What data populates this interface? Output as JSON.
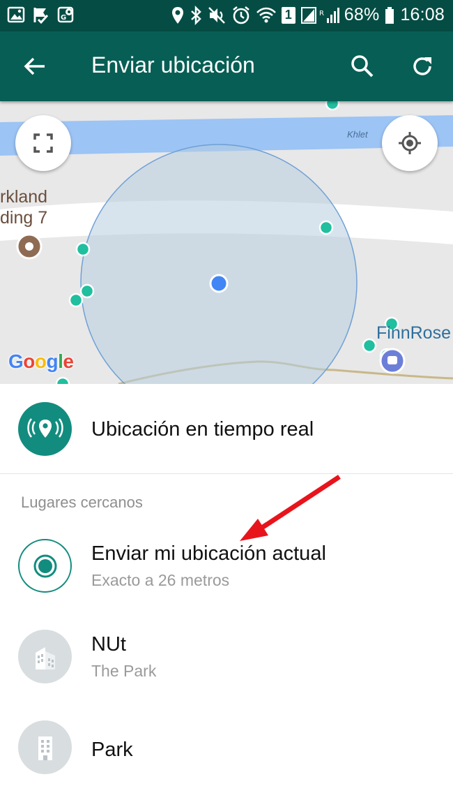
{
  "status_bar": {
    "battery": "68%",
    "time": "16:08",
    "sim_badge": "1"
  },
  "toolbar": {
    "title": "Enviar ubicación"
  },
  "map": {
    "place_label_line1": "rkland",
    "place_label_line2": "ding 7",
    "river_label": "Khlet",
    "poi_label": "FinnRose",
    "attribution": "Google"
  },
  "live_location": {
    "label": "Ubicación en tiempo real"
  },
  "nearby": {
    "header": "Lugares cercanos",
    "items": [
      {
        "title": "Enviar mi ubicación actual",
        "subtitle": "Exacto a 26 metros"
      },
      {
        "title": "NUt",
        "subtitle": "The Park"
      },
      {
        "title": "Park",
        "subtitle": ""
      }
    ]
  },
  "colors": {
    "status_bar": "#054d44",
    "toolbar": "#075e54",
    "accent": "#128c7e",
    "annotation_arrow": "#e8141c"
  }
}
